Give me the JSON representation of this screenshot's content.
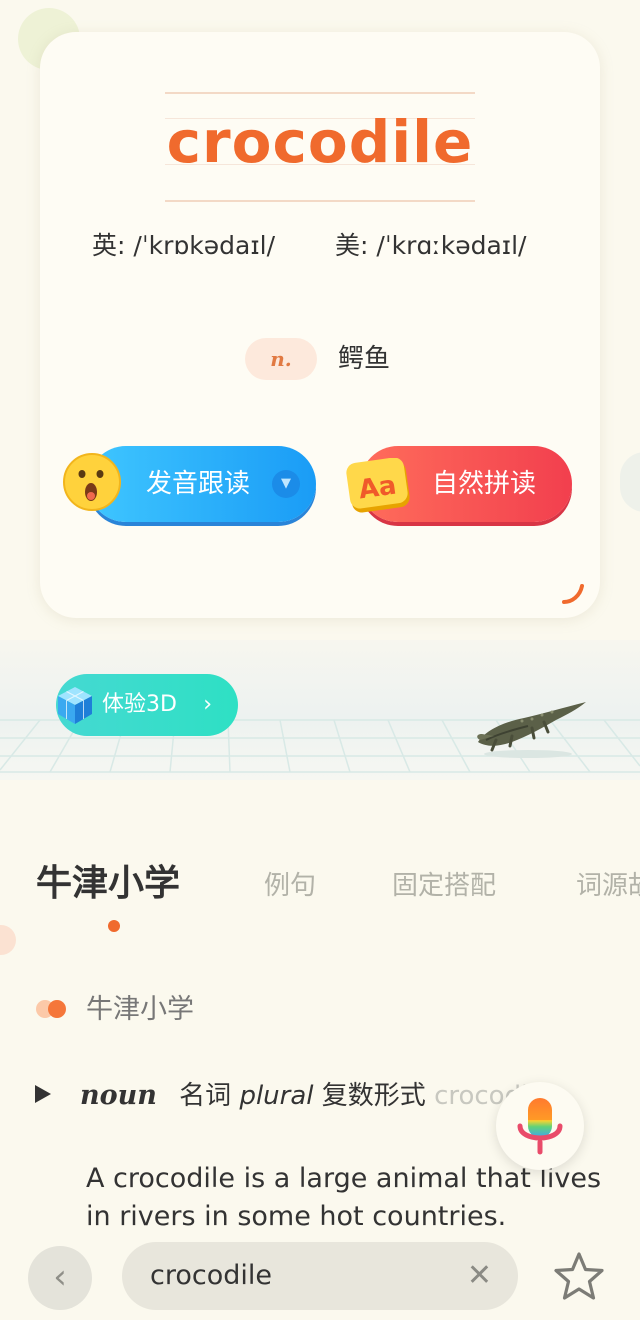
{
  "word": {
    "text": "crocodile",
    "uk_label": "英:",
    "uk_phonetic": "/ˈkrɒkədaɪl/",
    "us_label": "美:",
    "us_phonetic": "/ˈkrɑːkədaɪl/",
    "pos": "n.",
    "meaning": "鳄鱼"
  },
  "actions": {
    "pronounce_label": "发音跟读",
    "phonics_label": "自然拼读",
    "phonics_icon_text": "Aa"
  },
  "model3d": {
    "button_label": "体验3D",
    "chevron": "›"
  },
  "tabs": [
    {
      "label": "牛津小学",
      "active": true
    },
    {
      "label": "例句",
      "active": false
    },
    {
      "label": "固定搭配",
      "active": false
    },
    {
      "label": "词源故",
      "active": false
    }
  ],
  "section": {
    "title": "牛津小学",
    "pos_en": "noun",
    "pos_cn": "名词",
    "plural_en": "plural",
    "plural_cn": "复数形式",
    "plural_word": "crocodiles",
    "definition": "A crocodile is a large animal that lives in rivers in some hot countries."
  },
  "bottom": {
    "back_glyph": "‹",
    "search_value": "crocodile",
    "clear_glyph": "✕"
  },
  "colors": {
    "accent": "#f06a2d",
    "blue_button": "#1a9cf6",
    "red_button": "#f23f4e",
    "teal_button": "#2ee0c4",
    "background": "#fbf9ee"
  },
  "icons": [
    "surprised-face-icon",
    "aa-letters-icon",
    "cube-icon",
    "crocodile-image",
    "play-icon",
    "microphone-icon",
    "back-icon",
    "clear-icon",
    "star-icon"
  ]
}
